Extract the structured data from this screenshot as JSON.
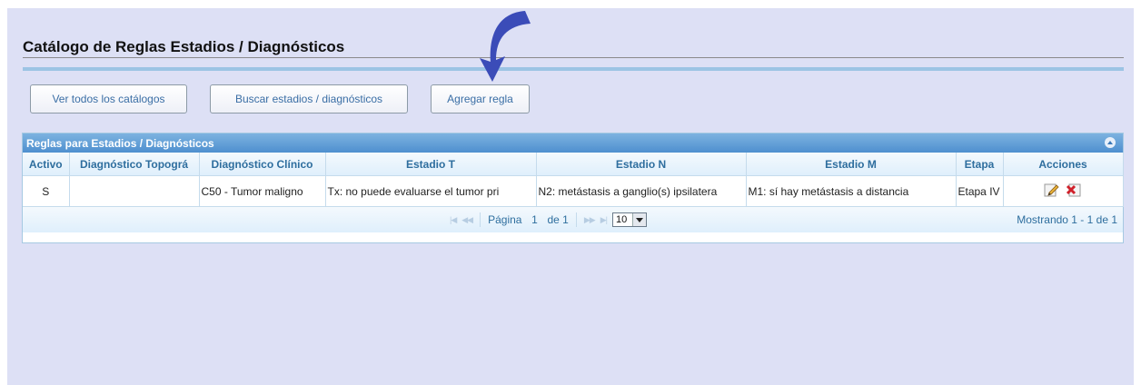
{
  "page": {
    "title": "Catálogo de Reglas Estadios / Diagnósticos"
  },
  "toolbar": {
    "view_all_label": "Ver todos los catálogos",
    "search_label": "Buscar estadios / diagnósticos",
    "add_rule_label": "Agregar regla"
  },
  "grid": {
    "caption": "Reglas para Estadios / Diagnósticos",
    "columns": [
      "Activo",
      "Diagnóstico Topográ",
      "Diagnóstico Clínico",
      "Estadio T",
      "Estadio N",
      "Estadio M",
      "Etapa",
      "Acciones"
    ],
    "rows": [
      {
        "activo": "S",
        "topografico": "",
        "clinico": "C50 - Tumor maligno",
        "estadio_t": "Tx: no puede evaluarse el tumor pri",
        "estadio_n": "N2: metástasis a ganglio(s) ipsilatera",
        "estadio_m": "M1: sí hay metástasis a distancia",
        "etapa": "Etapa IV",
        "actions": [
          "edit-icon",
          "delete-icon"
        ]
      }
    ],
    "pager": {
      "page_label": "Página",
      "page_value": "1",
      "of_label": "de 1",
      "rows_per_page": "10",
      "records_text": "Mostrando 1 - 1 de 1"
    }
  },
  "colors": {
    "panel_bg": "#dde0f5",
    "grid_header": "#4e8fcf",
    "accent_text": "#2e6e9e",
    "arrow": "#3b4cb8"
  }
}
